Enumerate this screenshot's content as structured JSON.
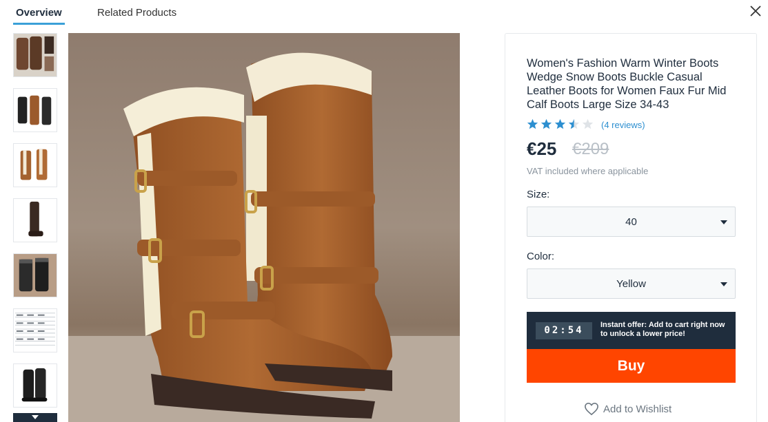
{
  "tabs": {
    "overview": "Overview",
    "related": "Related Products"
  },
  "close_icon": "close-icon",
  "thumbnails": [
    {
      "name": "thumbnail-boots-1"
    },
    {
      "name": "thumbnail-boots-2"
    },
    {
      "name": "thumbnail-boots-3"
    },
    {
      "name": "thumbnail-boots-4"
    },
    {
      "name": "thumbnail-boots-5"
    },
    {
      "name": "thumbnail-size-chart"
    },
    {
      "name": "thumbnail-boots-7"
    }
  ],
  "product": {
    "title": "Women's Fashion Warm Winter Boots Wedge Snow Boots Buckle Casual Leather Boots for Women Faux Fur Mid Calf Boots Large Size 34-43",
    "rating": 3.5,
    "rating_max": 5,
    "reviews": "(4 reviews)",
    "price": "€25",
    "old_price": "€209",
    "vat_note": "VAT included where applicable",
    "size_label": "Size:",
    "size_value": "40",
    "color_label": "Color:",
    "color_value": "Yellow",
    "timer": "02:54",
    "offer_text": "Instant offer: Add to cart right now to unlock a lower price!",
    "buy_label": "Buy",
    "wishlist_label": "Add to Wishlist"
  },
  "colors": {
    "accent": "#3aa0d8",
    "buy": "#ff4500",
    "dark": "#1f2d3d",
    "star": "#2d8fd0"
  }
}
